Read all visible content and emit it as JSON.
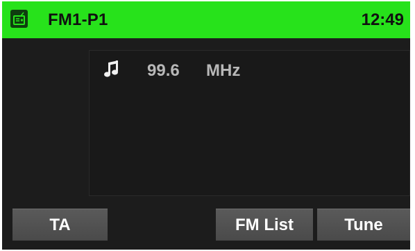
{
  "header": {
    "icon": "radio-icon",
    "station_title": "FM1-P1",
    "clock": "12:49"
  },
  "now_playing": {
    "icon": "music-note-icon",
    "frequency": "99.6",
    "unit": "MHz"
  },
  "buttons": {
    "ta_label": "TA",
    "fm_list_label": "FM List",
    "tune_label": "Tune"
  },
  "colors": {
    "header_bg": "#27e21b",
    "screen_bg": "#1c1c1c",
    "button_bg": "#545454",
    "frequency_text": "#b8b8b8"
  }
}
